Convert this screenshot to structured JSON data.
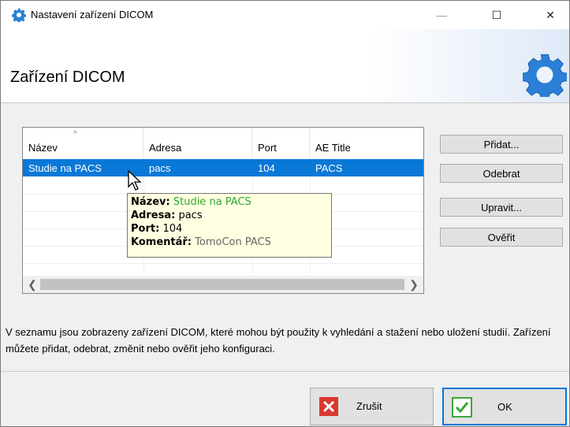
{
  "window": {
    "title": "Nastavení zařízení DICOM",
    "minimize_glyph": "—",
    "maximize_glyph": "☐",
    "close_glyph": "✕"
  },
  "header": {
    "title": "Zařízení DICOM",
    "icon": "gear-icon"
  },
  "table": {
    "columns": [
      "Název",
      "Adresa",
      "Port",
      "AE Title"
    ],
    "sort_indicator": "^",
    "rows": [
      {
        "name": "Studie na PACS",
        "address": "pacs",
        "port": "104",
        "ae_title": "PACS",
        "selected": true
      }
    ]
  },
  "tooltip": {
    "name_label": "Název:",
    "name_value": "Studie na PACS",
    "address_label": "Adresa:",
    "address_value": "pacs",
    "port_label": "Port:",
    "port_value": "104",
    "comment_label": "Komentář:",
    "comment_value": "TomoCon PACS"
  },
  "side_buttons": {
    "add": "Přidat...",
    "remove": "Odebrat",
    "edit": "Upravit...",
    "verify": "Ověřit"
  },
  "description": "V seznamu jsou zobrazeny zařízení DICOM, které mohou být použity k vyhledání a stažení nebo uložení studií. Zařízení můžete přidat, odebrat, změnit nebo ověřit jeho konfiguraci.",
  "footer": {
    "cancel_label": "Zrušit",
    "ok_label": "OK"
  },
  "colors": {
    "selection": "#0a78d7",
    "accent": "#0078d7",
    "cancel_red": "#d9392f",
    "ok_green": "#3aa53a"
  }
}
